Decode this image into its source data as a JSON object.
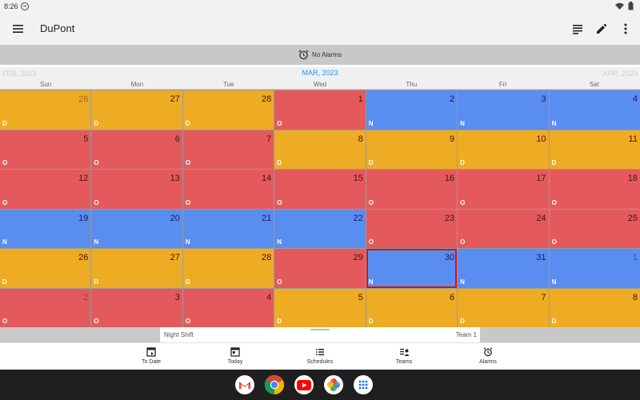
{
  "status": {
    "time": "8:26"
  },
  "appbar": {
    "title": "DuPont"
  },
  "alarm_bar": {
    "label": "No Alarms"
  },
  "month_nav": {
    "prev": "FEB, 2023",
    "current": "MAR, 2023",
    "next": "APR, 2023"
  },
  "weekdays": [
    "Sun",
    "Mon",
    "Tue",
    "Wed",
    "Thu",
    "Fri",
    "Sat"
  ],
  "weeks": [
    [
      {
        "day": "26",
        "shift": "D",
        "dim": true
      },
      {
        "day": "27",
        "shift": "D",
        "dim": false
      },
      {
        "day": "28",
        "shift": "D",
        "dim": false
      },
      {
        "day": "1",
        "shift": "O",
        "dim": false
      },
      {
        "day": "2",
        "shift": "N",
        "dim": false
      },
      {
        "day": "3",
        "shift": "N",
        "dim": false
      },
      {
        "day": "4",
        "shift": "N",
        "dim": false
      }
    ],
    [
      {
        "day": "5",
        "shift": "O",
        "dim": false
      },
      {
        "day": "6",
        "shift": "O",
        "dim": false
      },
      {
        "day": "7",
        "shift": "O",
        "dim": false
      },
      {
        "day": "8",
        "shift": "D",
        "dim": false
      },
      {
        "day": "9",
        "shift": "D",
        "dim": false
      },
      {
        "day": "10",
        "shift": "D",
        "dim": false
      },
      {
        "day": "11",
        "shift": "D",
        "dim": false
      }
    ],
    [
      {
        "day": "12",
        "shift": "O",
        "dim": false
      },
      {
        "day": "13",
        "shift": "O",
        "dim": false
      },
      {
        "day": "14",
        "shift": "O",
        "dim": false
      },
      {
        "day": "15",
        "shift": "O",
        "dim": false
      },
      {
        "day": "16",
        "shift": "O",
        "dim": false
      },
      {
        "day": "17",
        "shift": "O",
        "dim": false
      },
      {
        "day": "18",
        "shift": "O",
        "dim": false
      }
    ],
    [
      {
        "day": "19",
        "shift": "N",
        "dim": false
      },
      {
        "day": "20",
        "shift": "N",
        "dim": false
      },
      {
        "day": "21",
        "shift": "N",
        "dim": false
      },
      {
        "day": "22",
        "shift": "N",
        "dim": false
      },
      {
        "day": "23",
        "shift": "O",
        "dim": false
      },
      {
        "day": "24",
        "shift": "O",
        "dim": false
      },
      {
        "day": "25",
        "shift": "O",
        "dim": false
      }
    ],
    [
      {
        "day": "26",
        "shift": "D",
        "dim": false
      },
      {
        "day": "27",
        "shift": "D",
        "dim": false
      },
      {
        "day": "28",
        "shift": "D",
        "dim": false
      },
      {
        "day": "29",
        "shift": "O",
        "dim": false
      },
      {
        "day": "30",
        "shift": "N",
        "dim": false,
        "today": true
      },
      {
        "day": "31",
        "shift": "N",
        "dim": false
      },
      {
        "day": "1",
        "shift": "N",
        "dim": true
      }
    ],
    [
      {
        "day": "2",
        "shift": "O",
        "dim": true
      },
      {
        "day": "3",
        "shift": "O",
        "dim": false
      },
      {
        "day": "4",
        "shift": "O",
        "dim": false
      },
      {
        "day": "5",
        "shift": "D",
        "dim": false
      },
      {
        "day": "6",
        "shift": "D",
        "dim": false
      },
      {
        "day": "7",
        "shift": "D",
        "dim": false
      },
      {
        "day": "8",
        "shift": "D",
        "dim": false
      }
    ]
  ],
  "shift_colors": {
    "D": "#eeac24",
    "O": "#e45a5c",
    "N": "#5a8df0"
  },
  "bottom_sheet": {
    "left": "Night Shift",
    "right": "Team 1"
  },
  "bottom_nav": [
    {
      "label": "To Date",
      "icon": "to-date-icon"
    },
    {
      "label": "Today",
      "icon": "today-icon"
    },
    {
      "label": "Schedules",
      "icon": "schedules-icon"
    },
    {
      "label": "Teams",
      "icon": "teams-icon"
    },
    {
      "label": "Alarms",
      "icon": "alarm-icon"
    }
  ],
  "dock_apps": [
    "gmail-icon",
    "chrome-icon",
    "youtube-icon",
    "photos-icon",
    "app-drawer-icon"
  ]
}
